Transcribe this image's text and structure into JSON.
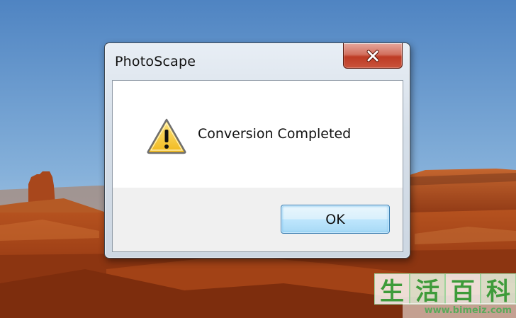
{
  "dialog": {
    "title": "PhotoScape",
    "message": "Conversion Completed",
    "ok_label": "OK",
    "icon": "warning-icon",
    "close_icon": "close-icon"
  },
  "watermark": {
    "chars": [
      "生",
      "活",
      "百",
      "科"
    ],
    "url": "www.bimeiz.com"
  },
  "colors": {
    "close_button": "#c9533b",
    "ok_button_border": "#3c7fb1",
    "warning_fill": "#f3c72c",
    "watermark_green": "#3e9b3a"
  }
}
